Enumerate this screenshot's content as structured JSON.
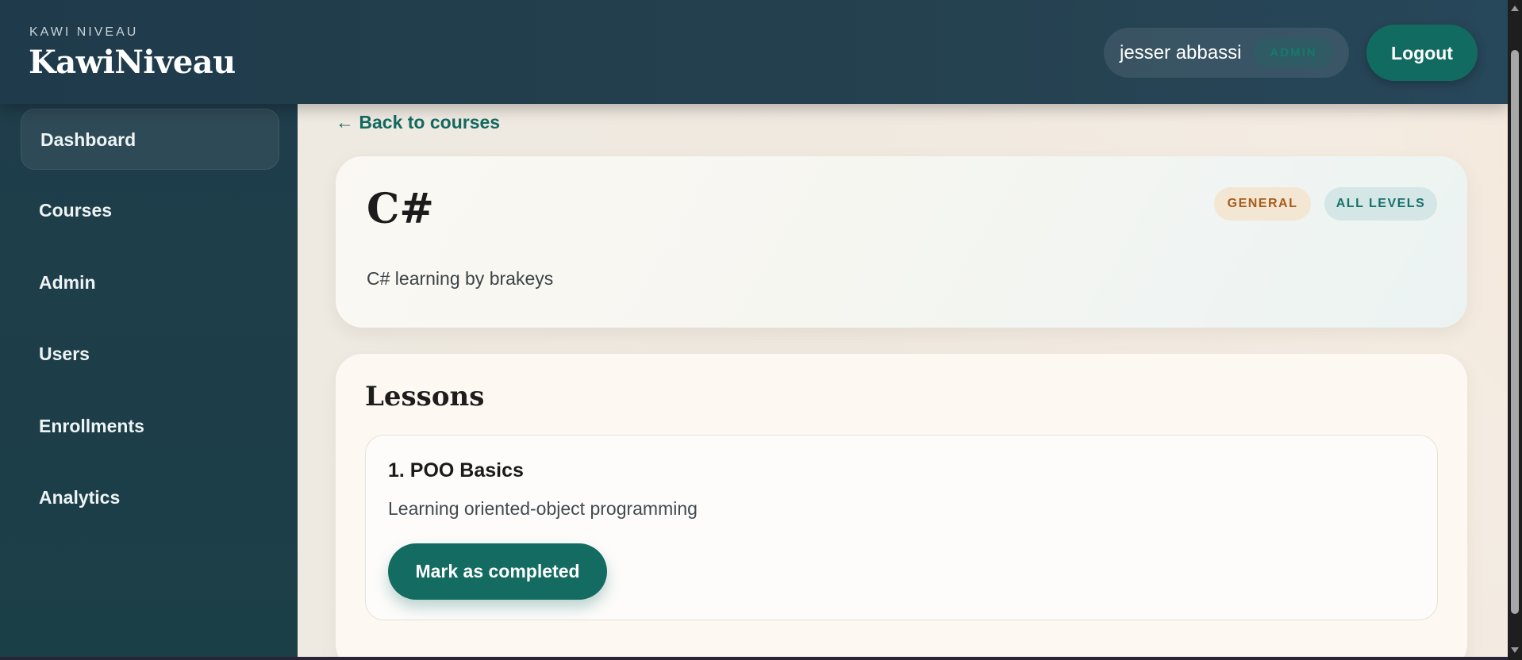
{
  "header": {
    "brand_kicker": "KAWI NIVEAU",
    "brand_name": "KawiNiveau",
    "user_name": "jesser abbassi",
    "user_role": "ADMIN",
    "logout_label": "Logout"
  },
  "sidebar": {
    "items": [
      {
        "label": "Dashboard",
        "active": true
      },
      {
        "label": "Courses",
        "active": false
      },
      {
        "label": "Admin",
        "active": false
      },
      {
        "label": "Users",
        "active": false
      },
      {
        "label": "Enrollments",
        "active": false
      },
      {
        "label": "Analytics",
        "active": false
      }
    ]
  },
  "main": {
    "back_link": "← Back to courses",
    "course": {
      "title": "C#",
      "description": "C# learning by brakeys",
      "category_tag": "GENERAL",
      "level_tag": "ALL LEVELS"
    },
    "lessons": {
      "heading": "Lessons",
      "items": [
        {
          "title": "1. POO Basics",
          "description": "Learning oriented-object programming",
          "action_label": "Mark as completed"
        }
      ]
    }
  },
  "colors": {
    "accent": "#126b61",
    "header_bg": "#24404f",
    "sidebar_bg": "#1d3e48",
    "page_bg": "#f2ebe2",
    "category_tag_text": "#a75c1b",
    "level_tag_text": "#19706a"
  }
}
